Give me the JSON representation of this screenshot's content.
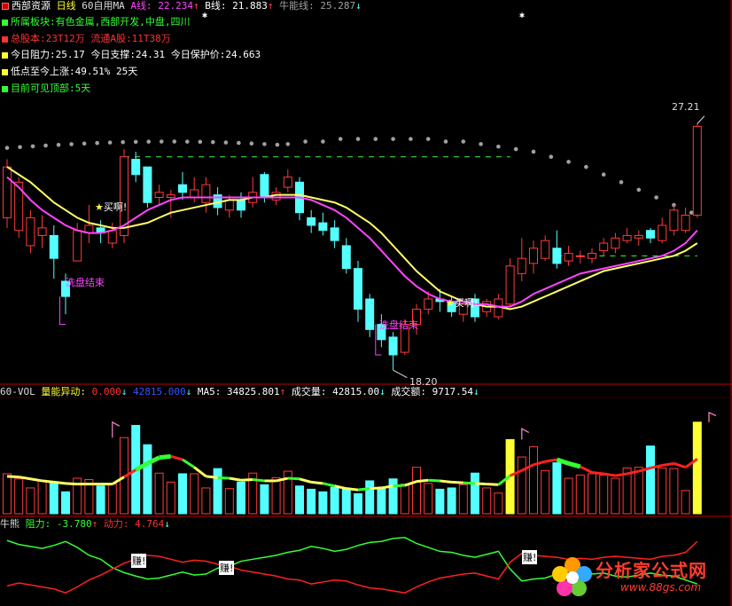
{
  "header": {
    "title": "西部资源",
    "period": "日线",
    "indicator": "60自用MA",
    "a_label": "A线: ",
    "a_value": "22.234",
    "a_arrow": "↑",
    "b_label": "B线: ",
    "b_value": "21.883",
    "b_arrow": "↑",
    "bull_label": "牛能线: ",
    "bull_value": "25.287",
    "bull_arrow": "↓"
  },
  "info": [
    {
      "text": "所属板块:有色金属,西部开发,中盘,四川",
      "color": "#33ff33"
    },
    {
      "text": "总股本:23T12万   流通A股:11T38万",
      "color": "#ff3333"
    },
    {
      "text": "今日阻力:25.17   今日支撑:24.31   今日保护价:24.663",
      "color": "#ffff33"
    },
    {
      "text": "低点至今上涨:49.51%   25天",
      "color": "#ffff33"
    },
    {
      "text": "目前可见顶部:5天",
      "color": "#33ff33"
    }
  ],
  "annotations": {
    "high_price": "27.21",
    "low_price": "18.20",
    "buy1": "买啊!",
    "buy2": "买啊!",
    "wash1": "洗盘结束",
    "wash2": "洗盘结束",
    "earn": "赚!"
  },
  "vol_header": {
    "name": "60-VOL",
    "p1_label": "量能异动: ",
    "p1_value": "0.000",
    "p1_arrow": "↓",
    "p2_value": "42815.000",
    "p2_arrow": "↓",
    "ma5_label": "MA5: ",
    "ma5_value": "34825.801",
    "ma5_arrow": "↑",
    "vol_label": "成交量: ",
    "vol_value": "42815.00",
    "vol_arrow": "↓",
    "amt_label": "成交额: ",
    "amt_value": "9717.54",
    "amt_arrow": "↓"
  },
  "bull_header": {
    "name": "牛熊",
    "res_label": "阻力: ",
    "res_value": "-3.780",
    "res_arrow": "↑",
    "pow_label": "动力: ",
    "pow_value": "4.764",
    "pow_arrow": "↓"
  },
  "watermark": {
    "title": "分析家公式网",
    "url": "www.88gs.com"
  },
  "colors": {
    "up": "#ff3b3b",
    "down": "#54ffff",
    "ma_a": "#ff44ff",
    "ma_b": "#ffff66",
    "dots": "#a0a0a0",
    "resist_green": "#33ff33",
    "resist_red": "#ff2020",
    "frame": "#c00000"
  },
  "chart_data": {
    "type": "candlestick",
    "title": "西部资源 日线",
    "ylim": [
      17.5,
      28.4
    ],
    "candles": [
      [
        23.6,
        25.6,
        25.9,
        23.2
      ],
      [
        23.1,
        25.0,
        25.2,
        22.8
      ],
      [
        22.5,
        23.6,
        23.9,
        22.2
      ],
      [
        22.9,
        23.2,
        23.7,
        22.4
      ],
      [
        22.9,
        22.0,
        23.3,
        21.2
      ],
      [
        21.1,
        20.5,
        21.4,
        19.8
      ],
      [
        21.9,
        23.1,
        23.4,
        21.9
      ],
      [
        23.0,
        23.3,
        24.1,
        22.6
      ],
      [
        23.2,
        23.0,
        23.5,
        22.6
      ],
      [
        22.6,
        23.1,
        23.4,
        22.4
      ],
      [
        22.9,
        26.0,
        26.3,
        22.6
      ],
      [
        25.9,
        25.3,
        26.2,
        25.0
      ],
      [
        25.6,
        24.2,
        25.6,
        24.0
      ],
      [
        24.4,
        24.6,
        24.9,
        24.1
      ],
      [
        24.4,
        24.5,
        24.7,
        23.6
      ],
      [
        24.9,
        24.6,
        25.4,
        24.3
      ],
      [
        24.4,
        24.7,
        25.2,
        24.2
      ],
      [
        24.2,
        24.9,
        25.2,
        23.8
      ],
      [
        24.5,
        24.0,
        24.8,
        23.7
      ],
      [
        23.9,
        24.3,
        24.5,
        23.6
      ],
      [
        24.3,
        23.9,
        24.6,
        23.6
      ],
      [
        24.2,
        24.6,
        25.2,
        24.0
      ],
      [
        25.3,
        24.4,
        25.4,
        24.2
      ],
      [
        24.3,
        24.6,
        24.8,
        24.1
      ],
      [
        24.8,
        25.2,
        25.5,
        24.6
      ],
      [
        25.0,
        23.8,
        25.2,
        23.5
      ],
      [
        23.6,
        23.3,
        23.9,
        23.0
      ],
      [
        23.4,
        23.1,
        23.8,
        22.9
      ],
      [
        23.2,
        22.7,
        23.5,
        22.4
      ],
      [
        22.5,
        21.6,
        22.8,
        21.4
      ],
      [
        21.6,
        20.0,
        21.9,
        19.5
      ],
      [
        20.4,
        19.2,
        20.6,
        18.9
      ],
      [
        19.4,
        18.8,
        19.8,
        18.5
      ],
      [
        18.9,
        18.2,
        19.1,
        17.6
      ],
      [
        18.3,
        19.4,
        19.6,
        18.2
      ],
      [
        19.4,
        20.0,
        20.2,
        19.0
      ],
      [
        20.0,
        20.4,
        20.7,
        19.8
      ],
      [
        20.4,
        20.3,
        20.8,
        19.9
      ],
      [
        20.3,
        19.9,
        20.5,
        19.7
      ],
      [
        19.8,
        20.2,
        20.3,
        19.5
      ],
      [
        20.4,
        19.7,
        20.6,
        19.5
      ],
      [
        19.9,
        20.3,
        20.4,
        19.7
      ],
      [
        19.7,
        20.4,
        20.6,
        19.6
      ],
      [
        20.2,
        21.7,
        22.0,
        20.1
      ],
      [
        21.4,
        22.0,
        22.8,
        21.1
      ],
      [
        21.8,
        22.4,
        22.7,
        21.4
      ],
      [
        22.0,
        22.7,
        22.9,
        21.9
      ],
      [
        22.4,
        21.8,
        23.1,
        21.6
      ],
      [
        21.9,
        22.2,
        22.5,
        21.7
      ],
      [
        22.1,
        22.1,
        22.3,
        21.8
      ],
      [
        22.0,
        22.2,
        22.4,
        21.8
      ],
      [
        22.3,
        22.6,
        22.8,
        22.1
      ],
      [
        22.4,
        22.8,
        23.0,
        22.2
      ],
      [
        22.7,
        22.9,
        23.2,
        22.6
      ],
      [
        22.8,
        22.9,
        23.1,
        22.5
      ],
      [
        23.1,
        22.8,
        23.2,
        22.6
      ],
      [
        22.7,
        23.3,
        23.6,
        22.6
      ],
      [
        23.1,
        23.9,
        24.1,
        22.9
      ],
      [
        23.1,
        23.7,
        24.0,
        23.0
      ],
      [
        23.7,
        27.2,
        27.3,
        23.6
      ]
    ],
    "ma_a": [
      25.2,
      24.8,
      24.3,
      23.9,
      23.6,
      23.3,
      23.1,
      23.0,
      23.0,
      23.1,
      23.3,
      23.6,
      23.9,
      24.1,
      24.3,
      24.4,
      24.4,
      24.4,
      24.4,
      24.4,
      24.4,
      24.4,
      24.4,
      24.4,
      24.4,
      24.4,
      24.3,
      24.1,
      23.9,
      23.6,
      23.2,
      22.8,
      22.3,
      21.8,
      21.3,
      20.9,
      20.6,
      20.4,
      20.3,
      20.3,
      20.2,
      20.2,
      20.1,
      20.1,
      20.3,
      20.6,
      20.8,
      21.0,
      21.2,
      21.4,
      21.5,
      21.6,
      21.7,
      21.8,
      21.9,
      22.0,
      22.1,
      22.3,
      22.6,
      23.1
    ],
    "ma_b": [
      25.6,
      25.3,
      25.0,
      24.6,
      24.2,
      23.9,
      23.6,
      23.4,
      23.3,
      23.2,
      23.2,
      23.3,
      23.4,
      23.6,
      23.8,
      23.9,
      24.0,
      24.1,
      24.2,
      24.3,
      24.3,
      24.4,
      24.4,
      24.5,
      24.5,
      24.5,
      24.4,
      24.3,
      24.2,
      24.0,
      23.7,
      23.4,
      23.0,
      22.5,
      22.0,
      21.5,
      21.1,
      20.7,
      20.5,
      20.3,
      20.2,
      20.1,
      20.1,
      20.0,
      20.1,
      20.3,
      20.5,
      20.7,
      20.9,
      21.1,
      21.3,
      21.5,
      21.6,
      21.7,
      21.8,
      21.9,
      22.0,
      22.1,
      22.3,
      22.6
    ],
    "resist_dots": [
      26.5,
      26.6,
      26.6,
      26.7,
      26.7,
      26.7,
      26.7,
      26.7,
      26.7,
      26.6,
      26.6,
      26.5,
      26.4,
      26.3,
      26.2,
      26.0,
      25.8,
      25.6,
      25.3,
      25.0,
      24.7,
      24.4,
      24.1,
      23.8
    ],
    "volumes": [
      6200,
      5400,
      4000,
      5200,
      4700,
      3400,
      5500,
      5300,
      4300,
      4600,
      11800,
      13700,
      10700,
      6300,
      4900,
      6200,
      6200,
      4000,
      7000,
      3900,
      4900,
      6300,
      4500,
      5600,
      6600,
      4300,
      3800,
      3400,
      4100,
      3800,
      3100,
      5100,
      4000,
      5400,
      4600,
      7200,
      4700,
      3800,
      4000,
      4500,
      6300,
      4000,
      3200,
      11500,
      8800,
      10400,
      6700,
      7900,
      5500,
      6000,
      6200,
      6000,
      5500,
      7100,
      7200,
      10500,
      7100,
      7000,
      3600,
      14200
    ],
    "vol_ma5": [
      5800,
      5700,
      5400,
      5100,
      4900,
      4700,
      4600,
      4600,
      4600,
      4600,
      5700,
      6800,
      7800,
      8700,
      8900,
      8400,
      7200,
      5800,
      5600,
      5500,
      5200,
      5300,
      5100,
      5100,
      5500,
      5400,
      4900,
      4700,
      4300,
      3900,
      3700,
      3900,
      4000,
      4300,
      4400,
      5000,
      5200,
      5100,
      4900,
      4800,
      4700,
      4600,
      4500,
      5900,
      6700,
      7600,
      8100,
      8400,
      7800,
      7300,
      6400,
      6200,
      5900,
      6200,
      6600,
      7100,
      7500,
      7800,
      7200,
      8500
    ],
    "bull_power": [
      5.0,
      4.2,
      3.8,
      3.4,
      4.0,
      4.8,
      3.6,
      2.0,
      1.2,
      -0.5,
      -1.5,
      -2.2,
      -2.8,
      -2.6,
      -2.0,
      -1.4,
      -2.0,
      -1.8,
      -0.6,
      -0.2,
      0.8,
      1.2,
      1.6,
      2.0,
      2.6,
      3.0,
      3.8,
      3.4,
      2.8,
      3.2,
      4.0,
      4.6,
      4.8,
      5.4,
      5.6,
      4.4,
      3.6,
      2.8,
      2.6,
      2.0,
      1.6,
      2.2,
      2.8,
      -0.8,
      -3.2,
      -2.8,
      -2.6,
      -1.8,
      -2.0,
      -1.2,
      -1.8,
      -1.6,
      -2.2,
      -2.4,
      -2.0,
      -1.6,
      -2.0,
      -2.2,
      -3.0,
      -3.8
    ],
    "bull_resist": [
      -4.2,
      -3.6,
      -4.0,
      -4.4,
      -4.8,
      -5.6,
      -4.4,
      -3.0,
      -2.0,
      -0.8,
      0.4,
      1.2,
      2.0,
      1.8,
      1.2,
      0.6,
      1.0,
      0.8,
      0.2,
      -0.2,
      -1.0,
      -1.4,
      -1.8,
      -2.2,
      -2.8,
      -3.0,
      -3.8,
      -3.4,
      -3.0,
      -3.2,
      -4.0,
      -4.6,
      -4.8,
      -5.2,
      -5.6,
      -4.4,
      -3.4,
      -2.6,
      -2.2,
      -1.8,
      -1.6,
      -2.2,
      -2.8,
      0.6,
      2.4,
      2.0,
      1.8,
      1.6,
      1.2,
      1.4,
      1.2,
      1.6,
      1.8,
      1.6,
      1.4,
      1.2,
      1.8,
      2.0,
      2.6,
      4.8
    ]
  }
}
